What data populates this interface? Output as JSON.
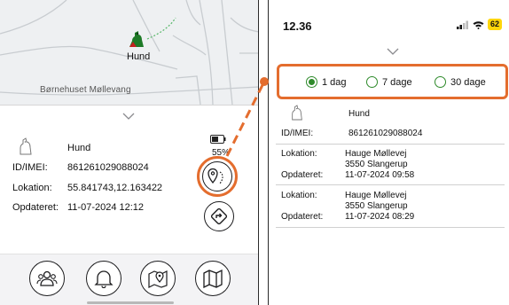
{
  "left_screen": {
    "map": {
      "dog_name": "Hund",
      "place_label": "Børnehuset Møllevang",
      "marker_icon": "dog-marker-icon"
    },
    "detail": {
      "dog_name": "Hund",
      "battery_pct": "55%",
      "rows": [
        {
          "label": "ID/IMEI:",
          "value": "861261029088024"
        },
        {
          "label": "Lokation:",
          "value": "55.841743,12.163422"
        },
        {
          "label": "Opdateret:",
          "value": "11-07-2024 12:12"
        }
      ]
    },
    "bottom_nav": [
      "people-icon",
      "bell-icon",
      "map-pin-icon",
      "map-icon"
    ]
  },
  "right_screen": {
    "status": {
      "time": "12.36",
      "battery": "62"
    },
    "period_options": [
      {
        "label": "1 dag",
        "selected": true
      },
      {
        "label": "7 dage",
        "selected": false
      },
      {
        "label": "30 dage",
        "selected": false
      }
    ],
    "dog": {
      "name": "Hund",
      "id_label": "ID/IMEI:",
      "id_value": "861261029088024"
    },
    "history": [
      {
        "lokation_label": "Lokation:",
        "address1": "Hauge Møllevej",
        "address2": "3550 Slangerup",
        "updated_label": "Opdateret:",
        "updated": "11-07-2024 09:58"
      },
      {
        "lokation_label": "Lokation:",
        "address1": "Hauge Møllevej",
        "address2": "3550 Slangerup",
        "updated_label": "Opdateret:",
        "updated": "11-07-2024 08:29"
      }
    ]
  },
  "colors": {
    "accent": "#e46d2e",
    "radio": "#2e8a2a",
    "battery_badge": "#ffd60a"
  }
}
